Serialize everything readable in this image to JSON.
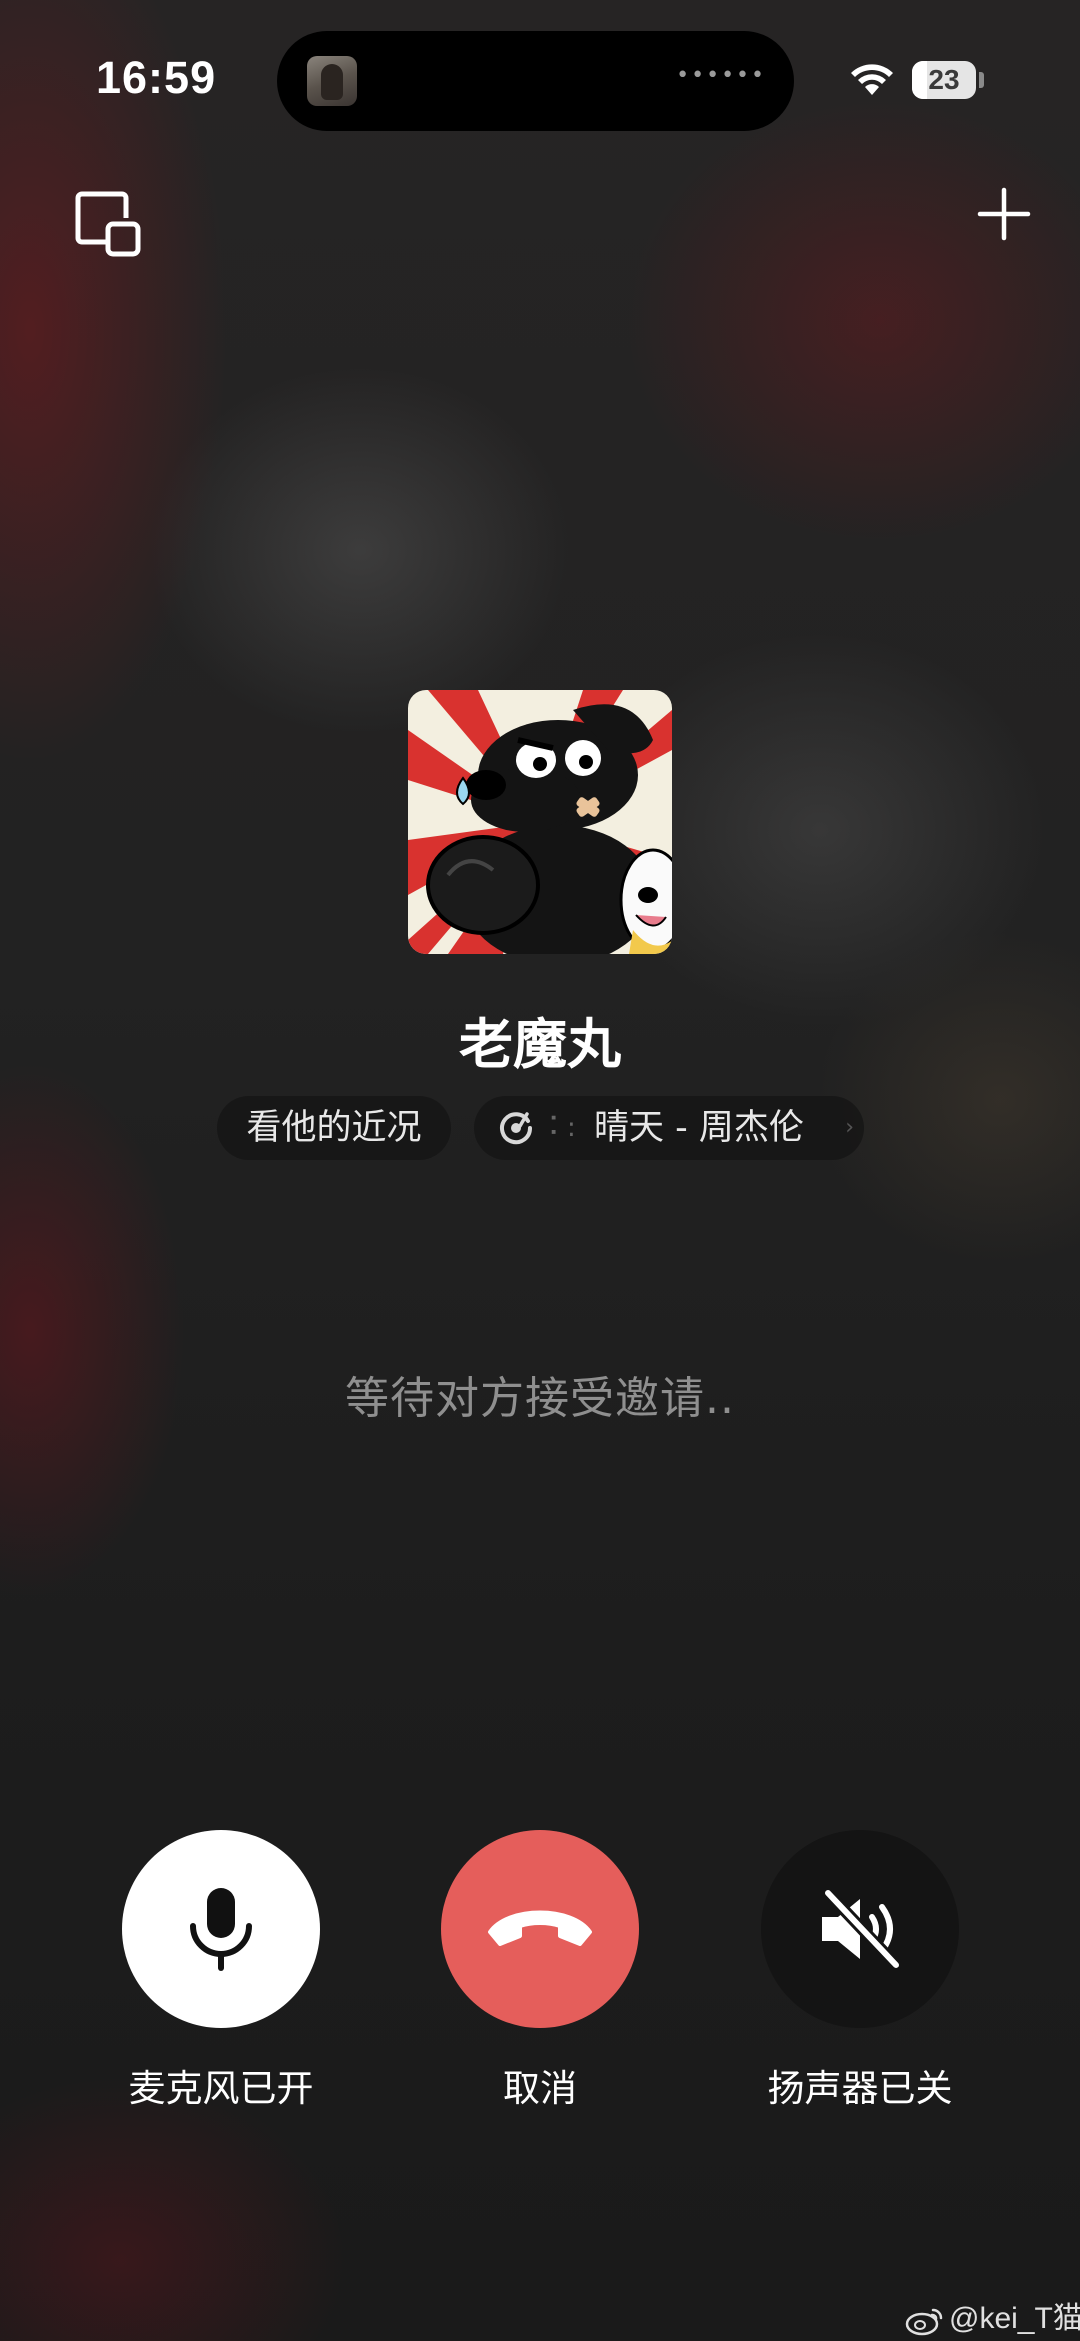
{
  "status_bar": {
    "time": "16:59",
    "battery_level": "23",
    "battery_fraction": 0.23,
    "wifi_icon": "wifi-icon"
  },
  "top_controls": {
    "minimize_icon": "window-minimize-icon",
    "add_icon": "plus-icon"
  },
  "contact": {
    "name": "老魔丸",
    "moments_label": "看他的近况",
    "music_icon": "music-disc-icon",
    "music_label": "晴天 - 周杰伦"
  },
  "call": {
    "status": "等待对方接受邀请.."
  },
  "controls": {
    "mic_label": "麦克风已开",
    "cancel_label": "取消",
    "speaker_label": "扬声器已关"
  },
  "watermark": {
    "text": "@kei_T猫"
  },
  "colors": {
    "cancel_red": "#e55e5b",
    "mic_white": "#ffffff",
    "speaker_dark": "#141414"
  }
}
